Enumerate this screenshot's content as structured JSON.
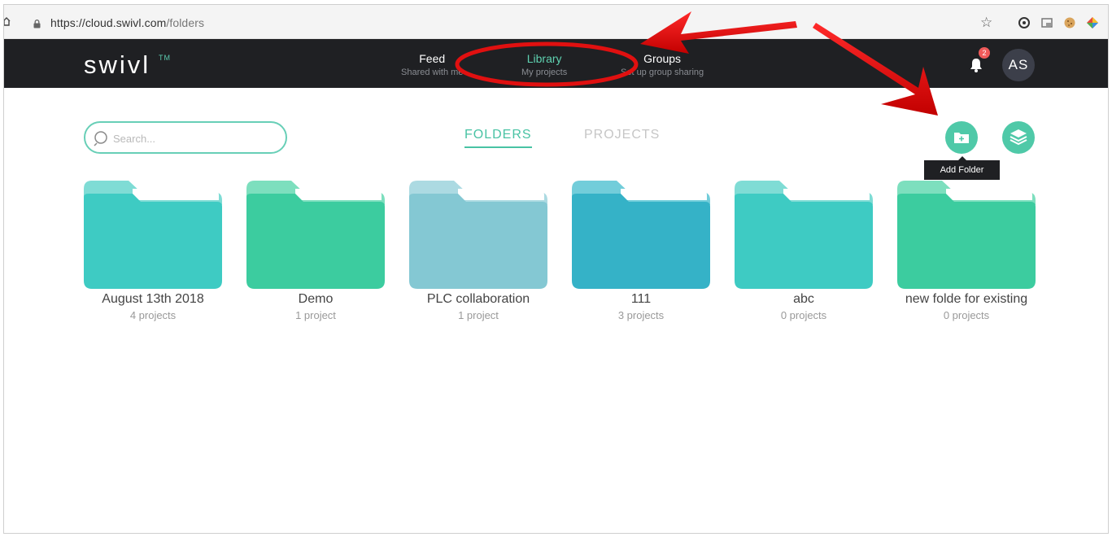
{
  "browser": {
    "url_host": "https://cloud.swivl.com",
    "url_path": "/folders"
  },
  "header": {
    "logo": "swivl",
    "logo_tm": "TM",
    "nav": [
      {
        "title": "Feed",
        "subtitle": "Shared with me"
      },
      {
        "title": "Library",
        "subtitle": "My projects"
      },
      {
        "title": "Groups",
        "subtitle": "Set up group sharing"
      }
    ],
    "notification_count": "2",
    "avatar_initials": "AS"
  },
  "search": {
    "placeholder": "Search..."
  },
  "tabs": {
    "folders": "FOLDERS",
    "projects": "PROJECTS"
  },
  "tooltip": "Add Folder",
  "colors": {
    "accent": "#49c3a4",
    "header_bg": "#1f2023",
    "annotation_red": "#e01010"
  },
  "folders": [
    {
      "name": "August 13th 2018",
      "count": "4 projects",
      "color": "#3ecbc3",
      "tab_color": "#7fdcd5"
    },
    {
      "name": "Demo",
      "count": "1 project",
      "color": "#3ccc9f",
      "tab_color": "#7ddfbe"
    },
    {
      "name": "PLC collaboration",
      "count": "1 project",
      "color": "#84c8d3",
      "tab_color": "#acdae2"
    },
    {
      "name": "111",
      "count": "3 projects",
      "color": "#35b2c7",
      "tab_color": "#72cdda"
    },
    {
      "name": "abc",
      "count": "0 projects",
      "color": "#3ecbc3",
      "tab_color": "#7fdcd5"
    },
    {
      "name": "new folde for existing",
      "count": "0 projects",
      "color": "#3ccc9f",
      "tab_color": "#7ddfbe"
    }
  ]
}
